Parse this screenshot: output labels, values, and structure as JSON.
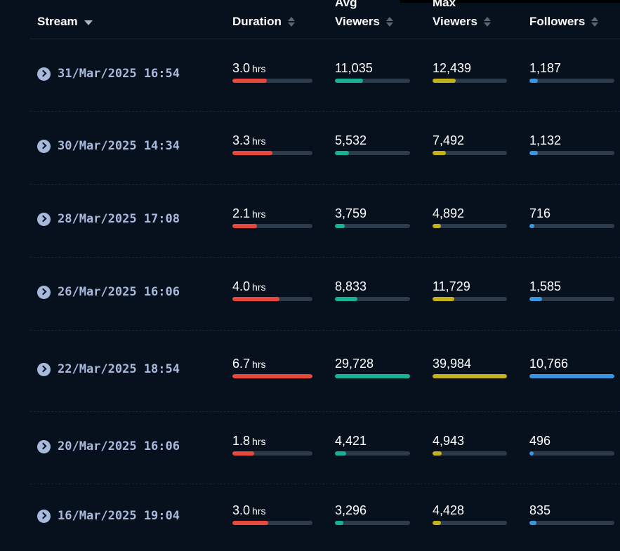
{
  "header": {
    "stream_label": "Stream",
    "duration_label": "Duration",
    "avg_viewers_line1": "Avg",
    "avg_viewers_line2": "Viewers",
    "max_viewers_line1": "Max",
    "max_viewers_line2": "Viewers",
    "followers_label": "Followers"
  },
  "colors": {
    "duration": "#e8473d",
    "avg_viewers": "#17b294",
    "max_viewers": "#c1b21c",
    "followers": "#3a95df"
  },
  "duration_unit": "hrs",
  "rows": [
    {
      "stream": "31/Mar/2025 16:54",
      "duration": "3.0",
      "avg_viewers": "11,035",
      "max_viewers": "12,439",
      "followers": "1,187",
      "duration_level": 0.43,
      "avg_level": 0.37,
      "max_level": 0.31,
      "followers_level": 0.1
    },
    {
      "stream": "30/Mar/2025 14:34",
      "duration": "3.3",
      "avg_viewers": "5,532",
      "max_viewers": "7,492",
      "followers": "1,132",
      "duration_level": 0.5,
      "avg_level": 0.19,
      "max_level": 0.18,
      "followers_level": 0.1
    },
    {
      "stream": "28/Mar/2025 17:08",
      "duration": "2.1",
      "avg_viewers": "3,759",
      "max_viewers": "4,892",
      "followers": "716",
      "duration_level": 0.31,
      "avg_level": 0.13,
      "max_level": 0.11,
      "followers_level": 0.06
    },
    {
      "stream": "26/Mar/2025 16:06",
      "duration": "4.0",
      "avg_viewers": "8,833",
      "max_viewers": "11,729",
      "followers": "1,585",
      "duration_level": 0.59,
      "avg_level": 0.3,
      "max_level": 0.29,
      "followers_level": 0.15
    },
    {
      "stream": "22/Mar/2025 18:54",
      "duration": "6.7",
      "avg_viewers": "29,728",
      "max_viewers": "39,984",
      "followers": "10,766",
      "duration_level": 1.0,
      "avg_level": 1.0,
      "max_level": 1.0,
      "followers_level": 1.0
    },
    {
      "stream": "20/Mar/2025 16:06",
      "duration": "1.8",
      "avg_viewers": "4,421",
      "max_viewers": "4,943",
      "followers": "496",
      "duration_level": 0.27,
      "avg_level": 0.15,
      "max_level": 0.12,
      "followers_level": 0.05
    },
    {
      "stream": "16/Mar/2025 19:04",
      "duration": "3.0",
      "avg_viewers": "3,296",
      "max_viewers": "4,428",
      "followers": "835",
      "duration_level": 0.45,
      "avg_level": 0.11,
      "max_level": 0.11,
      "followers_level": 0.08
    }
  ]
}
